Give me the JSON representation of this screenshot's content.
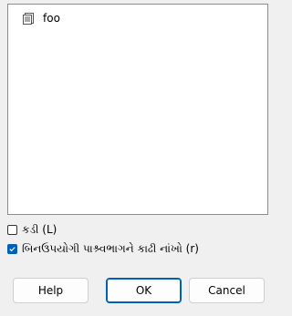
{
  "tree": {
    "items": [
      {
        "label": "foo",
        "icon": "document-icon"
      }
    ]
  },
  "options": {
    "checkbox_1": {
      "label": "કડી (L)",
      "checked": false
    },
    "checkbox_2": {
      "label": "બિનઉપયોગી પાશ્ર્વભાગને કાઢી નાંખો (r)",
      "checked": true
    }
  },
  "buttons": {
    "help": "Help",
    "ok": "OK",
    "cancel": "Cancel"
  },
  "colors": {
    "accent": "#005fb8",
    "window_bg": "#f0f0f0"
  }
}
